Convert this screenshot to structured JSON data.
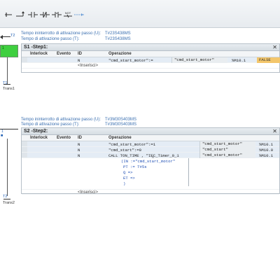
{
  "toolbar": {
    "icons": [
      "first-icon",
      "next-icon",
      "contact-no-icon",
      "contact-nc-icon",
      "contact-nc-not-icon",
      "not-icon",
      "connect-icon"
    ],
    "not_label": "NOT"
  },
  "sfc": {
    "step1_label": "1",
    "t2_label": "T2",
    "t1_label": "T1",
    "trans1_label": "Trans1",
    "t2b_label": "T2",
    "trans2_label": "Trans2",
    "colors": {
      "active_step": "#3fcf3f"
    }
  },
  "step1": {
    "info_line1_label": "Tempo ininterrotto di attivazione passo (U):",
    "info_line1_value": "T#23S438MS",
    "info_line2_label": "Tempo di attivazione passo (T):",
    "info_line2_value": "T#23S438MS",
    "title": "S1 -Step1:",
    "columns": [
      "Interlock",
      "Evento",
      "ID",
      "Operazione"
    ],
    "rows": [
      {
        "id": "N",
        "operation": "\"cmd_start_motor\":=",
        "tag_name": "\"cmd_start_motor\"",
        "tag_addr": "%M10.1",
        "tag_value": "FALSE"
      },
      {
        "id": "<Inserisci>",
        "operation": ""
      }
    ]
  },
  "step2": {
    "info_line1_label": "Tempo ininterrotto di attivazione passo (U):",
    "info_line1_value": "T#3M30S403MS",
    "info_line2_label": "Tempo di attivazione passo (T):",
    "info_line2_value": "T#3M30S403MS",
    "title": "S2 -Step2:",
    "columns": [
      "Interlock",
      "Evento",
      "ID",
      "Operazione"
    ],
    "rows": [
      {
        "id": "N",
        "operation": "\"cmd_start_motor\":=1",
        "tag_name": "\"cmd_start_motor\"",
        "tag_addr": "%M10.1"
      },
      {
        "id": "N",
        "operation": "\"cmd_start\":=0",
        "tag_name": "\"cmd_start\"",
        "tag_addr": "%M10.0"
      },
      {
        "id": "N",
        "operation": "CALL TON_TIME , \"IEC_Timer_0_1",
        "tag_name": "\"cmd_start_motor\"",
        "tag_addr": "%M10.1"
      }
    ],
    "call_lines": {
      "caret": "^",
      "in": "(IN :=\"cmd_start_motor\"",
      "pt": "PT := T#5s",
      "q": "Q =>",
      "et": "ET =>",
      "close": ")"
    },
    "insert_label": "<Inserisci>"
  }
}
